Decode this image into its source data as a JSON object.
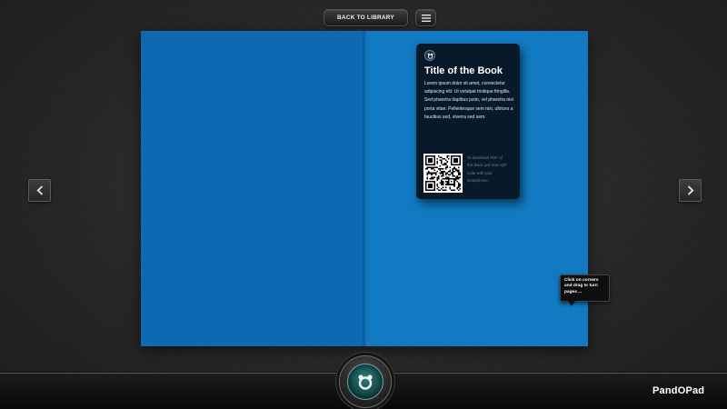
{
  "toolbar": {
    "back_label": "BACK TO LIBRARY",
    "menu_icon": "hamburger-menu-icon"
  },
  "book": {
    "left_page_color": "#0d6ab2",
    "right_page_color": "#117ac2"
  },
  "info_card": {
    "logo_icon": "pandopad-bear-icon",
    "title": "Title of the Book",
    "description": "Lorem ipsum dolor sit amet, consectetur adipiscing elit. Ut volutpat tristique fringilla. Sed pharetra dapibus justo, vel pharetra nisi porta vitae. Pellentesque sem nisi, ultrices a faucibus sed, viverra sed sem.",
    "qr_caption": "To download PDF of this Book just scan QR code with your smartphone."
  },
  "tooltip": {
    "text": "Click on corners and drag to turn pages ..."
  },
  "navigation": {
    "prev_icon": "chevron-left-icon",
    "next_icon": "chevron-right-icon"
  },
  "footer": {
    "home_icon": "bear-face-icon",
    "brand": "PandOPad"
  }
}
